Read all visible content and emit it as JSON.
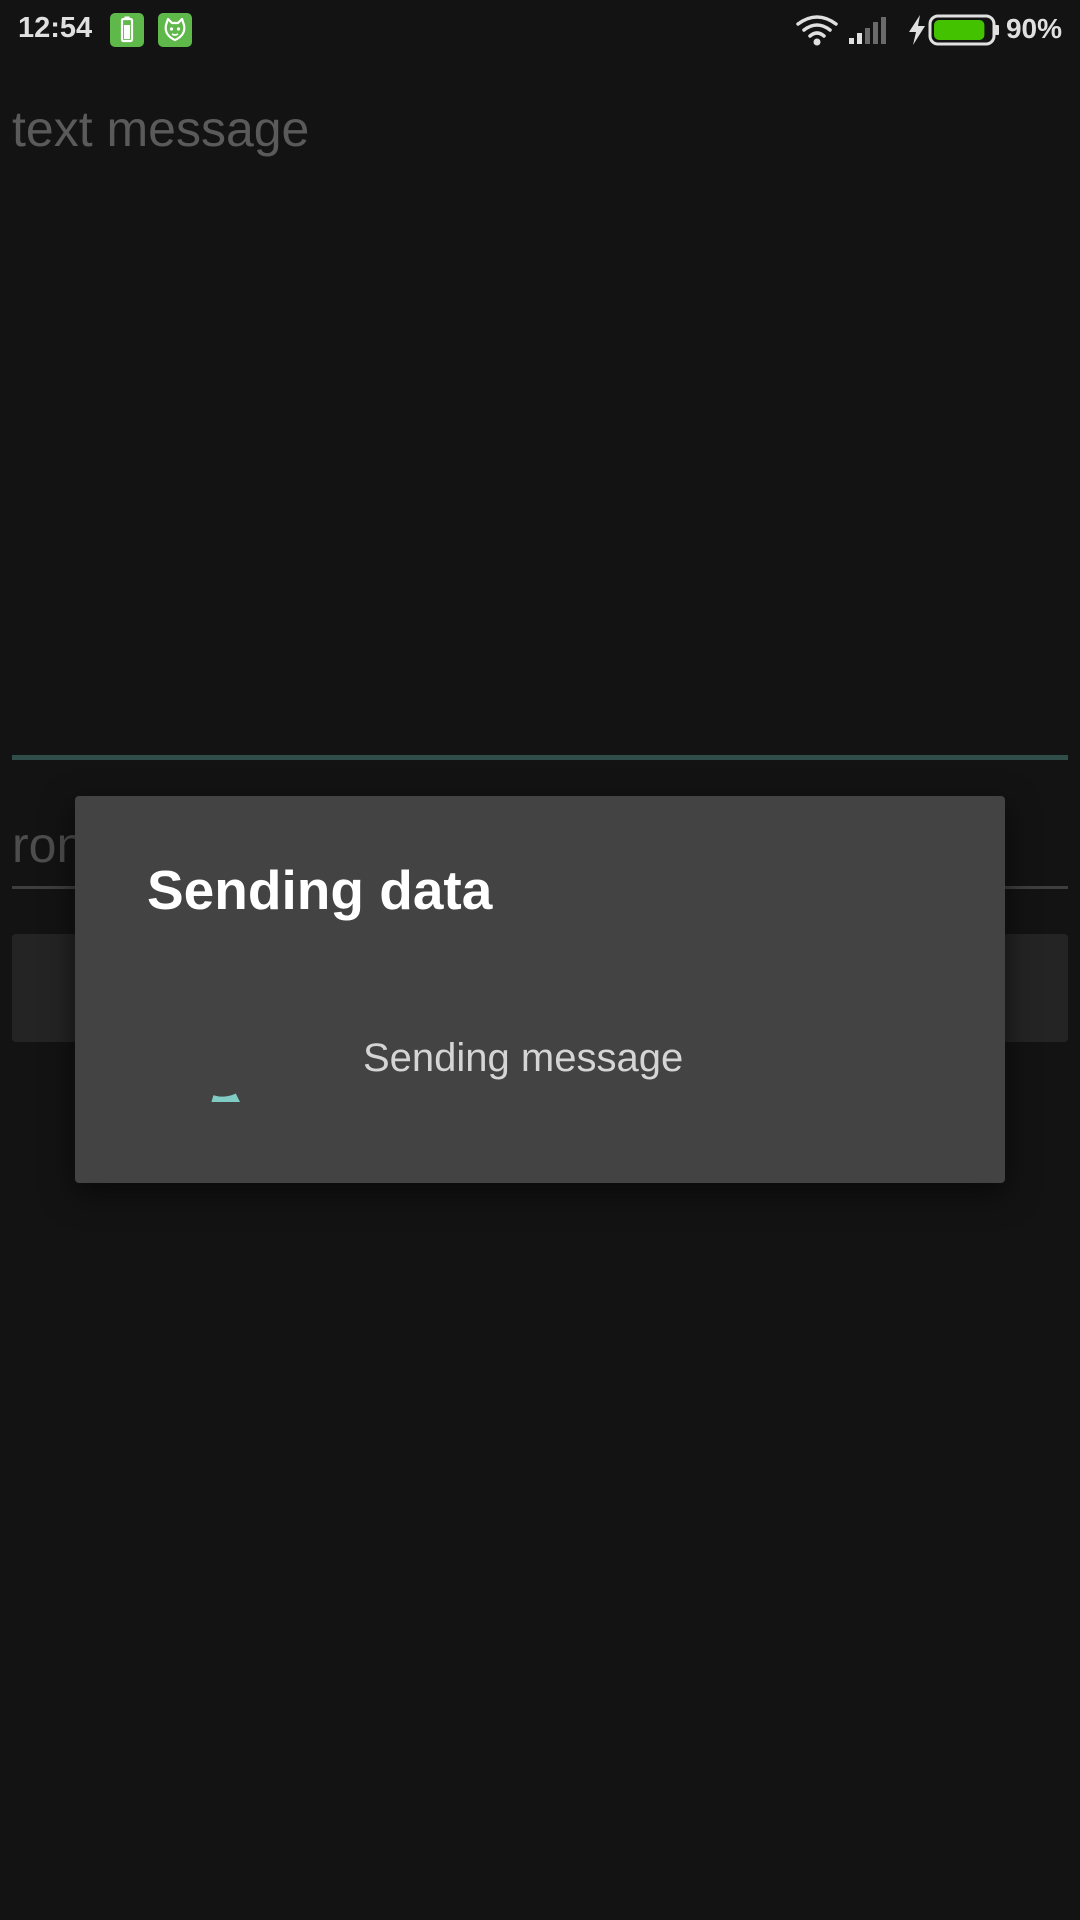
{
  "status_bar": {
    "time": "12:54",
    "battery_percent": "90%",
    "battery_level": 0.9,
    "icons": [
      "battery-saver-icon",
      "cat-face-icon",
      "wifi-icon",
      "cell-signal-icon",
      "charging-bolt-icon",
      "battery-icon"
    ],
    "battery_color": "#43c300"
  },
  "form": {
    "message_hint": "text message",
    "second_field_visible_text": "ron"
  },
  "dialog": {
    "title": "Sending data",
    "message": "Sending message",
    "spinner_color": "#80cbc4"
  }
}
